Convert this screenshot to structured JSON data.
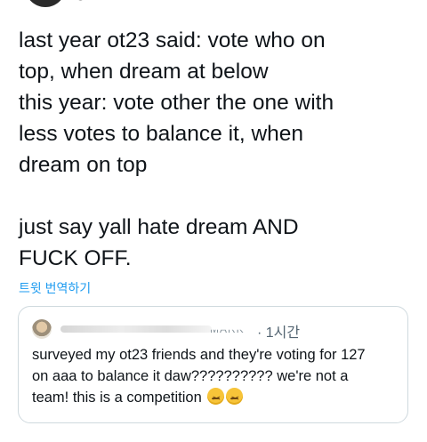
{
  "tweet": {
    "text": "last year ot23 said: vote who on\ntop, when dream at below\nthis year: vote other the one with\nless votes to balance it, when\ndream on top\n\njust say yall hate dream AND\nFUCK OFF.",
    "translate_label": "트윗 번역하기"
  },
  "quote": {
    "handle_fragment": "MARK",
    "time": "· 1시간",
    "text": "surveyed my ot23 friends and they're voting for 127\non aaa to balance it daw?????????? we're not a\nteam! this is a competition ",
    "emoji_icon": "confounded-face-emoji"
  }
}
